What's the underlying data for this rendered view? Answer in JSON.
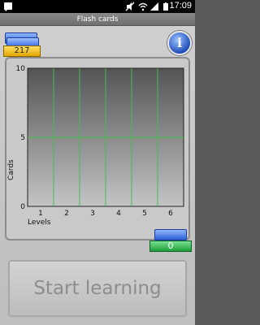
{
  "status_bar": {
    "time": "17:09",
    "icons": [
      "notification-icon",
      "mute-icon",
      "wifi-icon",
      "signal-icon",
      "battery-icon"
    ]
  },
  "app": {
    "title": "Flash cards"
  },
  "deck": {
    "count": "217"
  },
  "ready": {
    "count": "0"
  },
  "start_button": {
    "label": "Start learning"
  },
  "chart_data": {
    "type": "bar",
    "categories": [
      "1",
      "2",
      "3",
      "4",
      "5",
      "6"
    ],
    "values": [
      0,
      0,
      0,
      0,
      0,
      0
    ],
    "title": "",
    "xlabel": "Levels",
    "ylabel": "Cards",
    "ylim": [
      0,
      10
    ],
    "yticks": [
      "0",
      "5",
      "10"
    ],
    "grid": true,
    "grid_color": "#3ec24a"
  }
}
